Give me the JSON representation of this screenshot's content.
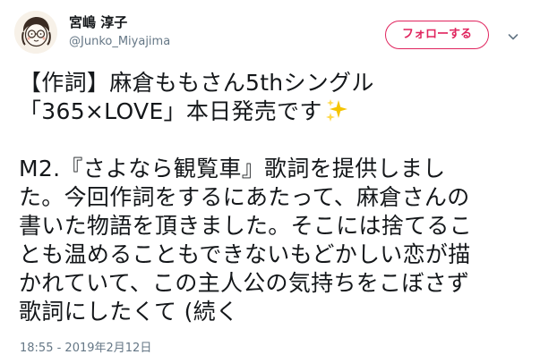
{
  "author": {
    "display_name": "宮嶋 淳子",
    "handle": "@Junko_Miyajima"
  },
  "follow_button_label": "フォローする",
  "colors": {
    "accent": "#e0245e",
    "text_primary": "#14171a",
    "text_secondary": "#657786"
  },
  "icons": {
    "menu": "chevron-down-icon",
    "emoji": "sparkles-icon"
  },
  "tweet": {
    "lines": [
      "【作詞】麻倉ももさん5thシングル",
      "「365×LOVE」本日発売です",
      "",
      "M2.『さよなら観覧車』歌詞を提供しまし",
      "た。今回作詞をするにあたって、麻倉さんの",
      "書いた物語を頂きました。そこには捨てるこ",
      "とも温めることもできないもどかしい恋が描",
      "かれていて、この主人公の気持ちをこぼさず",
      "歌詞にしたくて (続く"
    ]
  },
  "timestamp": "18:55 - 2019年2月12日"
}
